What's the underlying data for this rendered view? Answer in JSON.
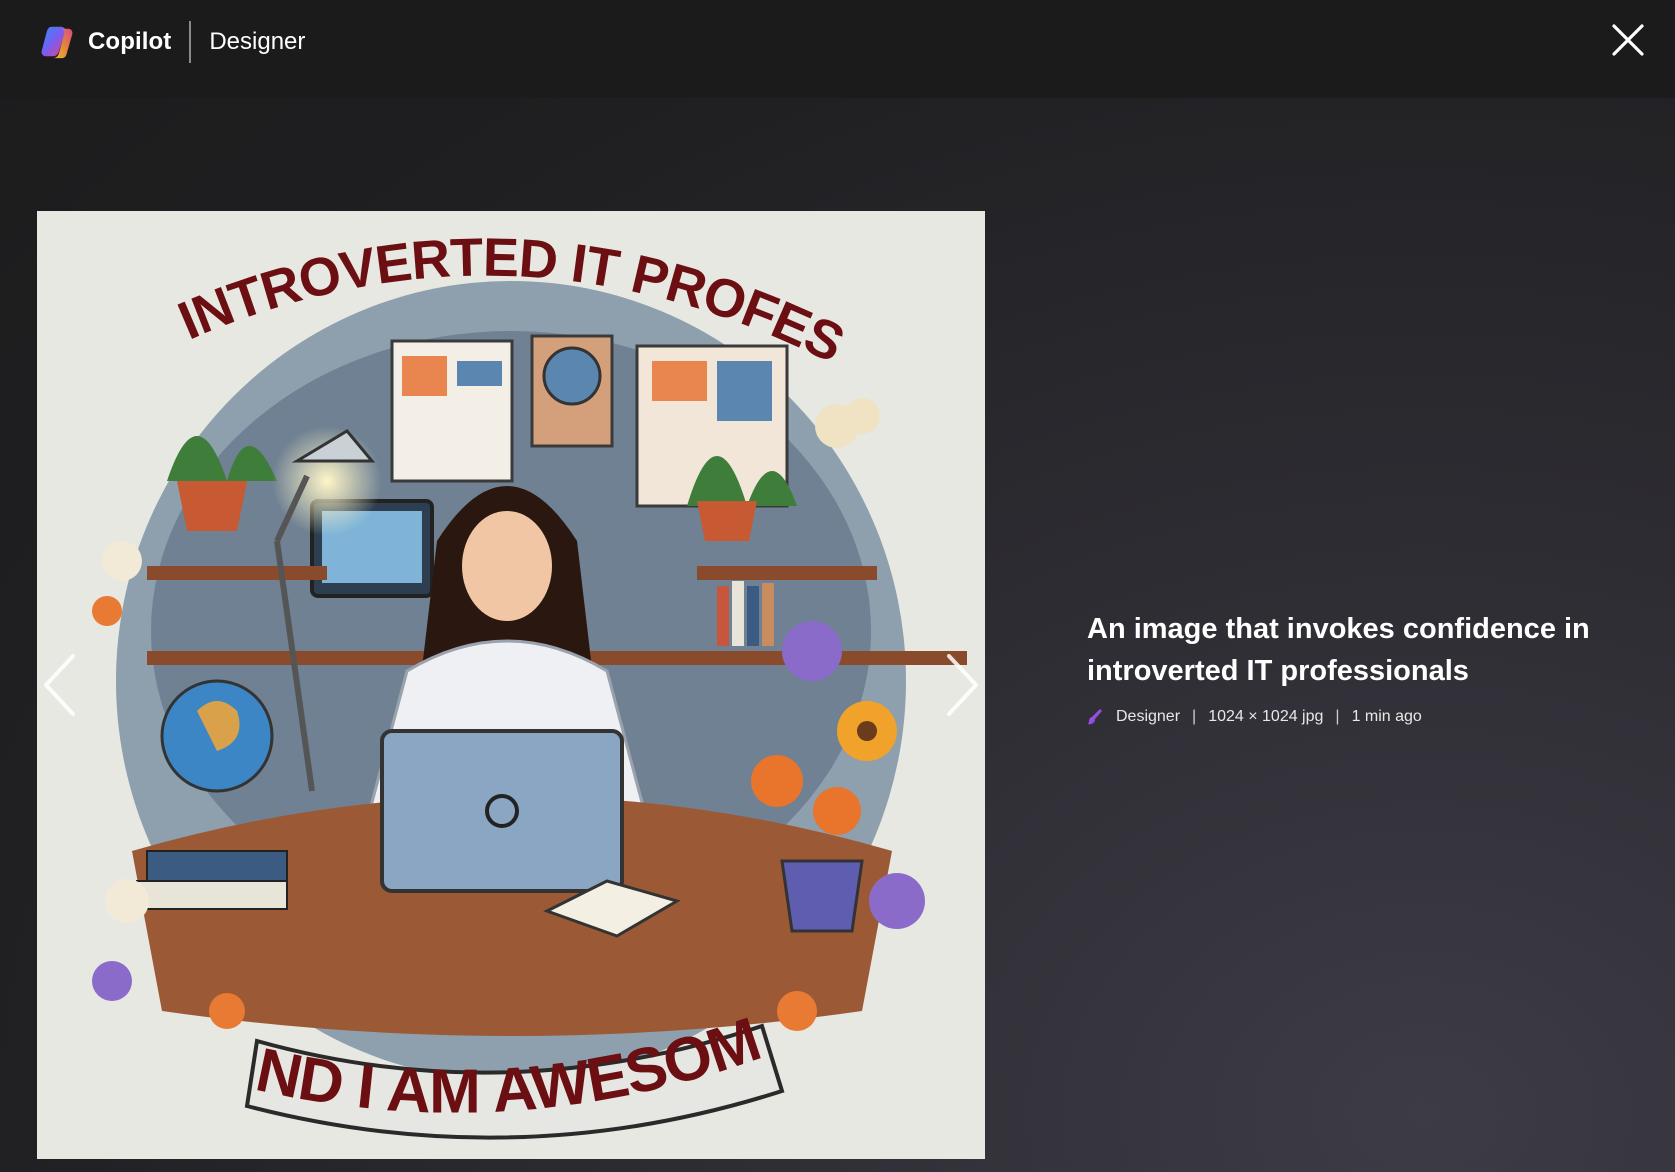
{
  "header": {
    "brand_name": "Copilot",
    "section_name": "Designer",
    "logo_icon": "copilot-logo-icon",
    "close_icon": "close-icon"
  },
  "image": {
    "top_banner_text": "I AM A INTROVERTED IT PROFESIONAL",
    "bottom_banner_text": "AND I AM AWESOME"
  },
  "navigation": {
    "prev_icon": "chevron-left-icon",
    "next_icon": "chevron-right-icon"
  },
  "details": {
    "caption": "An image that invokes confidence in introverted IT professionals",
    "source_icon": "designer-icon",
    "source": "Designer",
    "separator": "|",
    "dimensions": "1024 × 1024 jpg",
    "time": "1 min ago"
  },
  "colors": {
    "page_background": "#1f1f21",
    "topbar_background": "#1b1b1b",
    "image_background": "#e7e8e2",
    "banner_text": "#6b0f12"
  }
}
